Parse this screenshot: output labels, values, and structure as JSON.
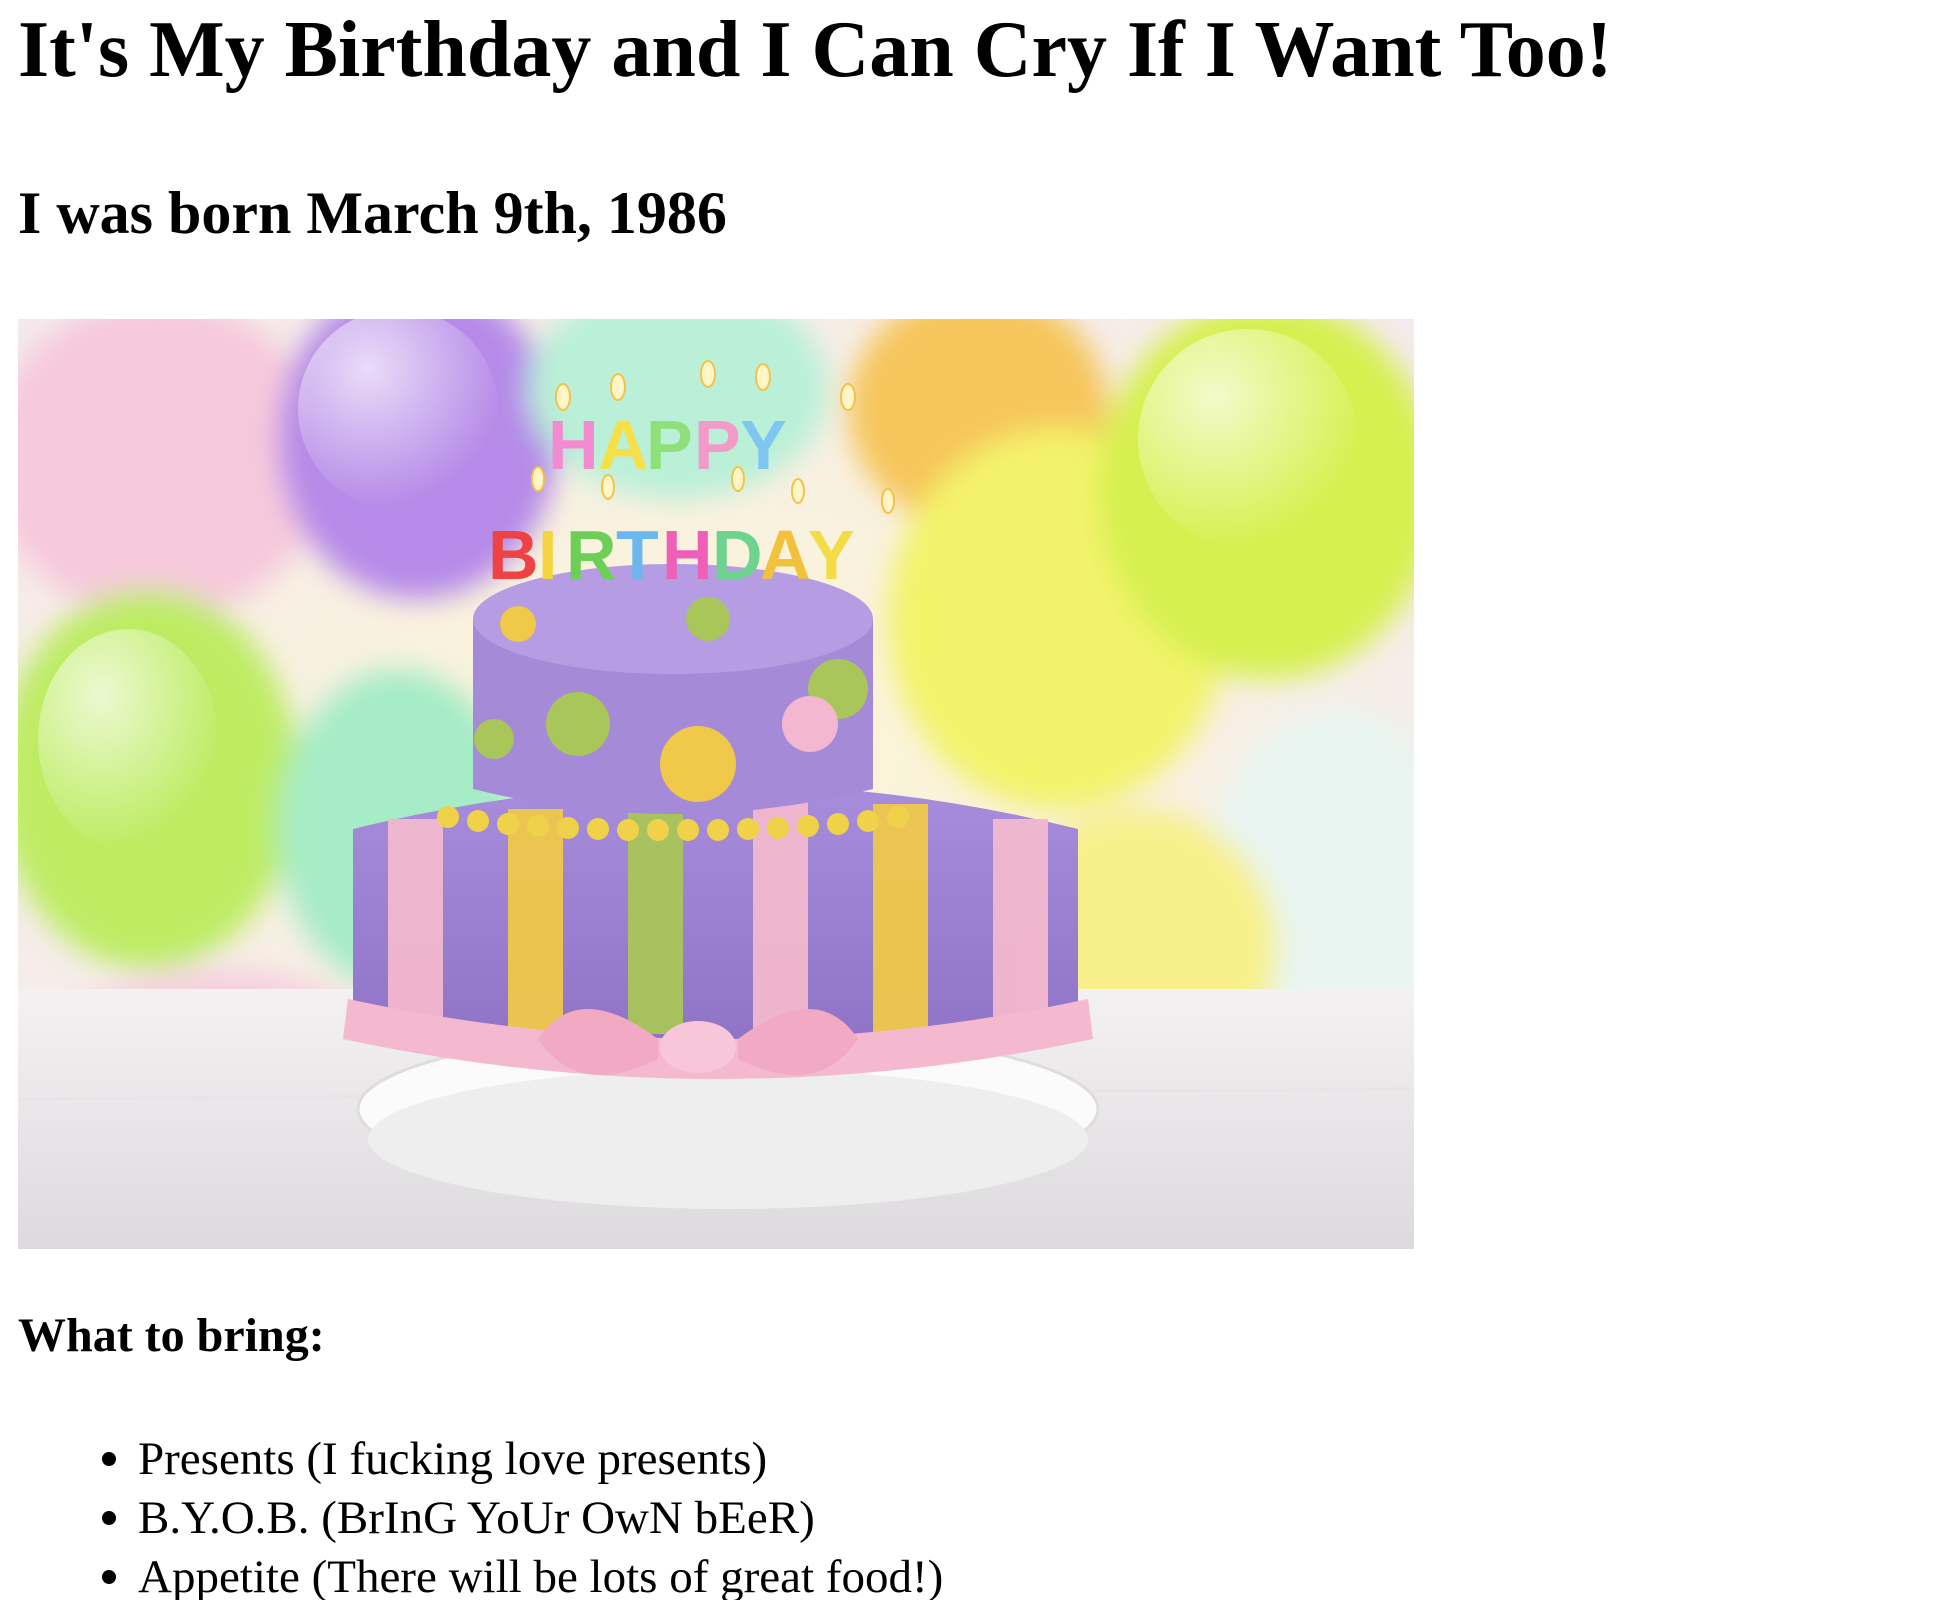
{
  "page": {
    "title": "It's My Birthday and I Can Cry If I Want Too!",
    "subtitle": "I was born March 9th, 1986"
  },
  "image": {
    "subject": "birthday-cake",
    "candles_text": "HAPPY BIRTHDAY"
  },
  "bring": {
    "heading": "What to bring:",
    "items": [
      "Presents (I fucking love presents)",
      "B.Y.O.B. (BrInG YoUr OwN bEeR)",
      "Appetite (There will be lots of great food!)"
    ]
  },
  "colors": {
    "text": "#000000",
    "background": "#ffffff",
    "cake_purple": "#9b7fd4",
    "cake_pink": "#f3b8cf",
    "cake_yellow": "#f0c84a",
    "cake_green": "#a9c65a"
  }
}
